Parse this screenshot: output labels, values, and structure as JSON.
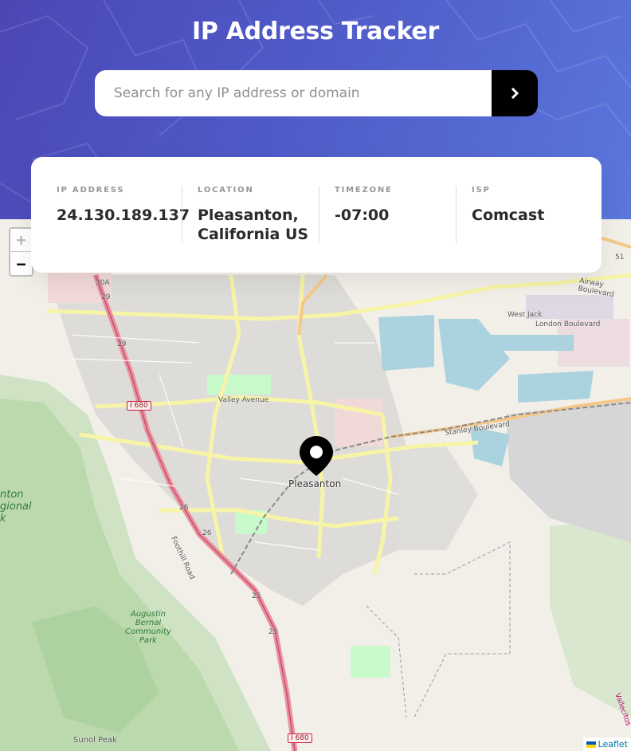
{
  "header": {
    "title": "IP Address Tracker",
    "search_placeholder": "Search for any IP address or domain",
    "search_value": "",
    "submit_icon": "chevron-right-icon"
  },
  "info": {
    "ip": {
      "label": "IP ADDRESS",
      "value": "24.130.189.137"
    },
    "location": {
      "label": "LOCATION",
      "value_line1": "Pleasanton,",
      "value_line2": "California US"
    },
    "timezone": {
      "label": "TIMEZONE",
      "value": "-07:00"
    },
    "isp": {
      "label": "ISP",
      "value": "Comcast"
    }
  },
  "map": {
    "zoom_in": "+",
    "zoom_out": "−",
    "attribution": "Leaflet",
    "marker_icon": "location-pin-icon",
    "city": "Pleasanton",
    "labels": {
      "valley_avenue": "Valley Avenue",
      "stanley_boulevard": "Stanley Boulevard",
      "foothill_road": "Foothill Road",
      "airway_boulevard": "Airway Boulevard",
      "london_boulevard": "London Boulevard",
      "west_jack": "West Jack",
      "park_name_1": "Augustin",
      "park_name_2": "Bernal",
      "park_name_3": "Community",
      "park_name_4": "Park",
      "regional_1": "nton",
      "regional_2": "gional",
      "regional_3": "k",
      "sunol_peak": "Sunol Peak",
      "vallecitos": "Vallecitos",
      "i680_a": "I 680",
      "i680_b": "I 680",
      "exit_30a": "30A",
      "exit_29a": "29",
      "exit_29b": "29",
      "exit_26a": "26",
      "exit_26b": "26",
      "exit_25a": "25",
      "exit_25b": "25",
      "exit_51": "51"
    }
  },
  "colors": {
    "header_start": "#4b47b5",
    "header_end": "#5b77dc",
    "button": "#000000",
    "text_dark": "#2b2b2b",
    "label_gray": "#969696"
  }
}
